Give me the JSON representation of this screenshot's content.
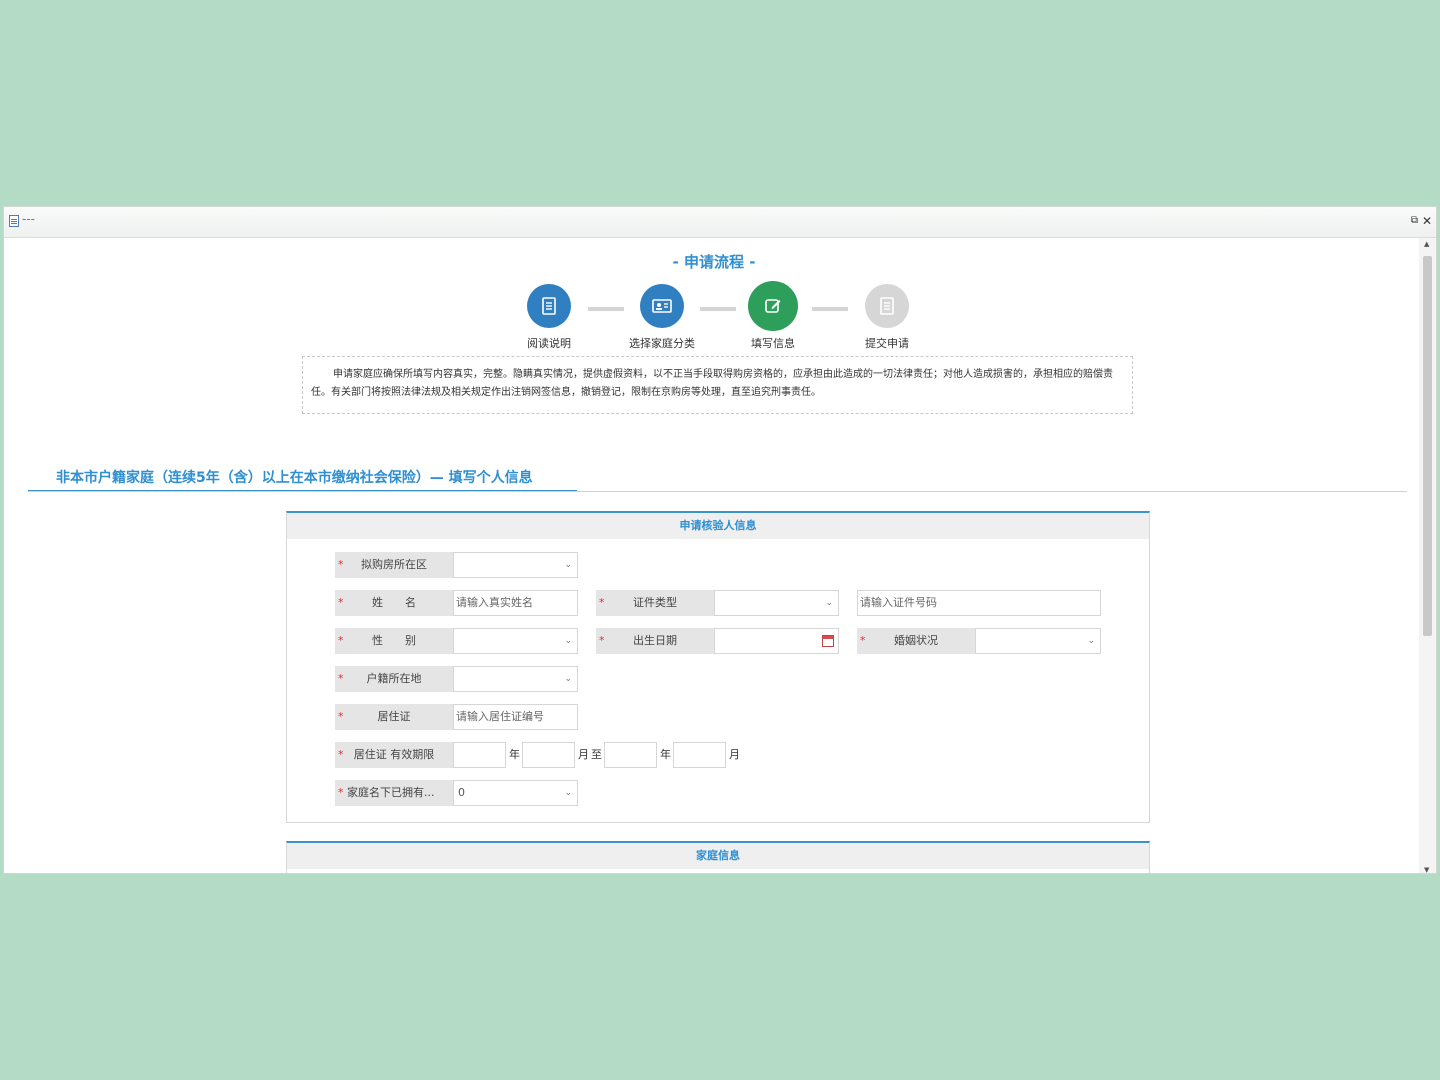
{
  "window": {
    "title": "---"
  },
  "process": {
    "title": "- 申请流程 -",
    "steps": [
      {
        "label": "阅读说明",
        "icon": "document-icon",
        "status": "done",
        "color": "#2f7fc1"
      },
      {
        "label": "选择家庭分类",
        "icon": "id-card-icon",
        "status": "done",
        "color": "#2f7fc1"
      },
      {
        "label": "填写信息",
        "icon": "edit-icon",
        "status": "current",
        "color": "#2e9e5b"
      },
      {
        "label": "提交申请",
        "icon": "document-icon",
        "status": "pending",
        "color": "#cfcfcf"
      }
    ]
  },
  "notice": "申请家庭应确保所填写内容真实，完整。隐瞒真实情况，提供虚假资料，以不正当手段取得购房资格的，应承担由此造成的一切法律责任；对他人造成损害的，承担相应的赔偿责任。有关部门将按照法律法规及相关规定作出注销网签信息，撤销登记，限制在京购房等处理，直至追究刑事责任。",
  "section_title": "非本市户籍家庭（连续5年（含）以上在本市缴纳社会保险）— 填写个人信息",
  "applicant_panel": {
    "title": "申请核验人信息",
    "required_mark": "*",
    "district": {
      "label": "拟购房所在区",
      "value": ""
    },
    "name": {
      "label": "姓　　名",
      "placeholder": "请输入真实姓名"
    },
    "id_type": {
      "label": "证件类型",
      "value": ""
    },
    "id_number": {
      "placeholder": "请输入证件号码"
    },
    "gender": {
      "label": "性　　别",
      "value": ""
    },
    "birth_date": {
      "label": "出生日期",
      "value": ""
    },
    "marital_status": {
      "label": "婚姻状况",
      "value": ""
    },
    "hukou": {
      "label": "户籍所在地",
      "value": ""
    },
    "residence_permit": {
      "label": "居住证",
      "placeholder": "请输入居住证编号"
    },
    "permit_validity": {
      "label": "居住证 有效期限",
      "year_unit": "年",
      "month_unit": "月",
      "to": "至"
    },
    "owned_homes": {
      "label": "家庭名下已拥有...",
      "value": "0"
    }
  },
  "family_panel": {
    "title": "家庭信息"
  },
  "colors": {
    "accent": "#2f8fd0",
    "background": "#b4dbc6",
    "required": "#e03030"
  }
}
